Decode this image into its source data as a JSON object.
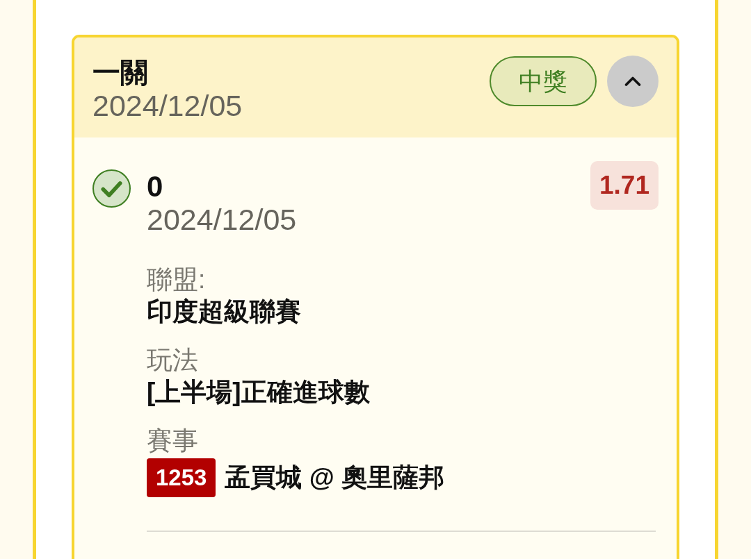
{
  "bet": {
    "title": "一關",
    "date": "2024/12/05",
    "status": {
      "kind": "won",
      "label": "中獎"
    },
    "expanded": true,
    "selections": [
      {
        "kind": "won",
        "pick": "0",
        "date": "2024/12/05",
        "odds": "1.71",
        "fields": [
          {
            "kind": "text",
            "label": "聯盟:",
            "value": "印度超級聯賽"
          },
          {
            "kind": "text",
            "label": "玩法",
            "value": "[上半場]正確進球數"
          },
          {
            "kind": "match",
            "label": "賽事",
            "match_number": "1253",
            "value": "孟買城 @ 奧里薩邦"
          }
        ]
      }
    ]
  }
}
